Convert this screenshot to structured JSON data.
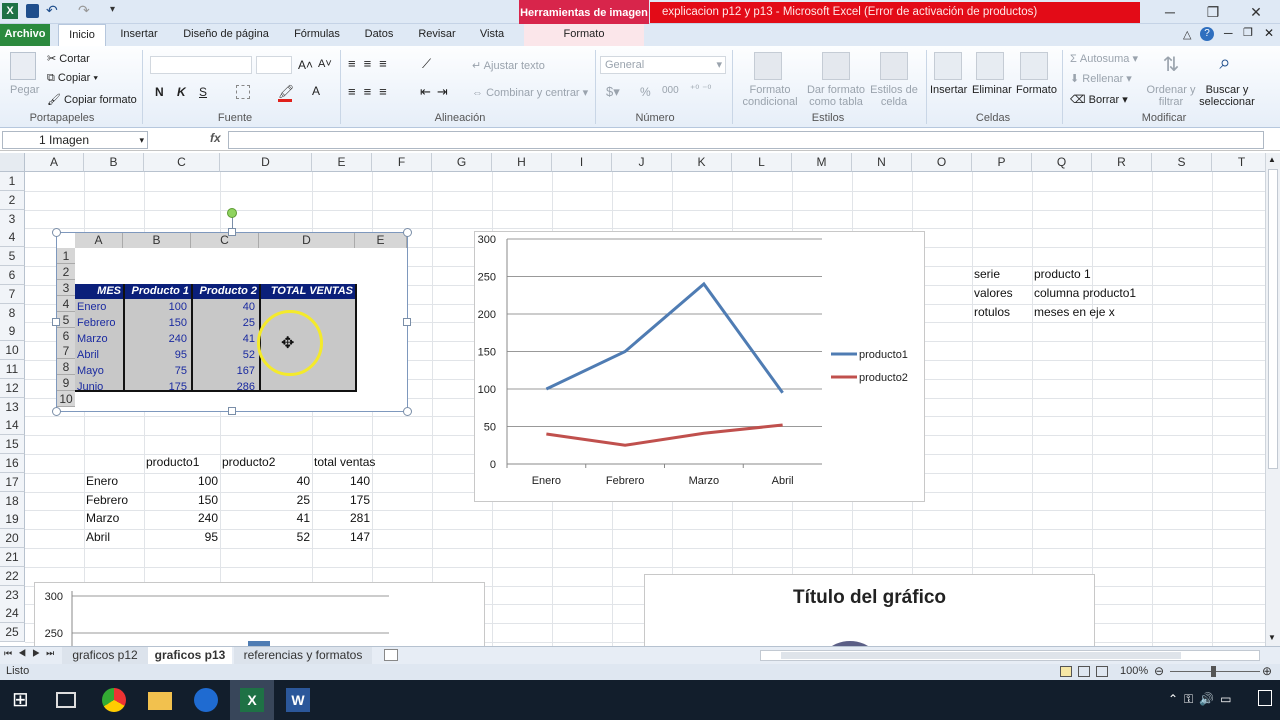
{
  "window": {
    "contextual_tab": "Herramientas de imagen",
    "title": "explicacion p12 y p13  -  Microsoft Excel (Error de activación de productos)"
  },
  "ribbon_tabs": [
    "Archivo",
    "Inicio",
    "Insertar",
    "Diseño de página",
    "Fórmulas",
    "Datos",
    "Revisar",
    "Vista",
    "Formato"
  ],
  "ribbon": {
    "portapapeles": {
      "pegar": "Pegar",
      "cortar": "Cortar",
      "copiar": "Copiar",
      "copiar_formato": "Copiar formato",
      "label": "Portapapeles"
    },
    "fuente": {
      "bold": "N",
      "italic": "K",
      "underline": "S",
      "label": "Fuente"
    },
    "alineacion": {
      "ajustar": "Ajustar texto",
      "combinar": "Combinar y centrar",
      "label": "Alineación"
    },
    "numero": {
      "format": "General",
      "percent": "%",
      "thousands": "000",
      "label": "Número"
    },
    "estilos": {
      "condicional": "Formato condicional",
      "tabla": "Dar formato como tabla",
      "celda": "Estilos de celda",
      "label": "Estilos"
    },
    "celdas": {
      "insertar": "Insertar",
      "eliminar": "Eliminar",
      "formato": "Formato",
      "label": "Celdas"
    },
    "modificar": {
      "autosuma": "Autosuma",
      "rellenar": "Rellenar",
      "borrar": "Borrar",
      "ordenar": "Ordenar y filtrar",
      "buscar": "Buscar y seleccionar",
      "label": "Modificar"
    }
  },
  "formula_bar": {
    "name_box": "1 Imagen",
    "fx": "fx",
    "value": ""
  },
  "columns": [
    "A",
    "B",
    "C",
    "D",
    "E",
    "F",
    "G",
    "H",
    "I",
    "J",
    "K",
    "L",
    "M",
    "N",
    "O",
    "P",
    "Q",
    "R",
    "S",
    "T"
  ],
  "rows": [
    "1",
    "2",
    "3",
    "4",
    "5",
    "6",
    "7",
    "8",
    "9",
    "10",
    "11",
    "12",
    "13",
    "14",
    "15",
    "16",
    "17",
    "18",
    "19",
    "20",
    "21",
    "22",
    "23",
    "24",
    "25"
  ],
  "embedded_image": {
    "cols": [
      "A",
      "B",
      "C",
      "D",
      "E"
    ],
    "rows": [
      "1",
      "2",
      "3",
      "4",
      "5",
      "6",
      "7",
      "8",
      "9",
      "10"
    ],
    "headers": [
      "MES",
      "Producto 1",
      "Producto 2",
      "TOTAL VENTAS"
    ],
    "data": [
      [
        "Enero",
        "100",
        "40"
      ],
      [
        "Febrero",
        "150",
        "25"
      ],
      [
        "Marzo",
        "240",
        "41"
      ],
      [
        "Abril",
        "95",
        "52"
      ],
      [
        "Mayo",
        "75",
        "167"
      ],
      [
        "Junio",
        "175",
        "286"
      ]
    ]
  },
  "table": {
    "headers": [
      "producto1",
      "producto2",
      "total ventas"
    ],
    "rows": [
      [
        "Enero",
        "100",
        "40",
        "140"
      ],
      [
        "Febrero",
        "150",
        "25",
        "175"
      ],
      [
        "Marzo",
        "240",
        "41",
        "281"
      ],
      [
        "Abril",
        "95",
        "52",
        "147"
      ]
    ]
  },
  "notes": [
    [
      "serie",
      "producto 1"
    ],
    [
      "valores",
      "columna producto1"
    ],
    [
      "rotulos",
      "meses en eje x"
    ]
  ],
  "chart_data": [
    {
      "type": "line",
      "categories": [
        "Enero",
        "Febrero",
        "Marzo",
        "Abril"
      ],
      "series": [
        {
          "name": "producto1",
          "values": [
            100,
            150,
            240,
            95
          ],
          "color": "#4f7cb3"
        },
        {
          "name": "producto2",
          "values": [
            40,
            25,
            41,
            52
          ],
          "color": "#c0504d"
        }
      ],
      "ylim": [
        0,
        300
      ],
      "yticks": [
        0,
        50,
        100,
        150,
        200,
        250,
        300
      ],
      "grid": true,
      "legend": "right"
    },
    {
      "type": "bar",
      "yticks": [
        250,
        300
      ],
      "partial": true
    },
    {
      "type": "pie",
      "title": "Título del gráfico",
      "partial": true
    }
  ],
  "sheets": [
    "graficos p12",
    "graficos p13",
    "referencias y formatos"
  ],
  "active_sheet": "graficos p13",
  "status": {
    "mode": "Listo",
    "zoom": "100%"
  }
}
